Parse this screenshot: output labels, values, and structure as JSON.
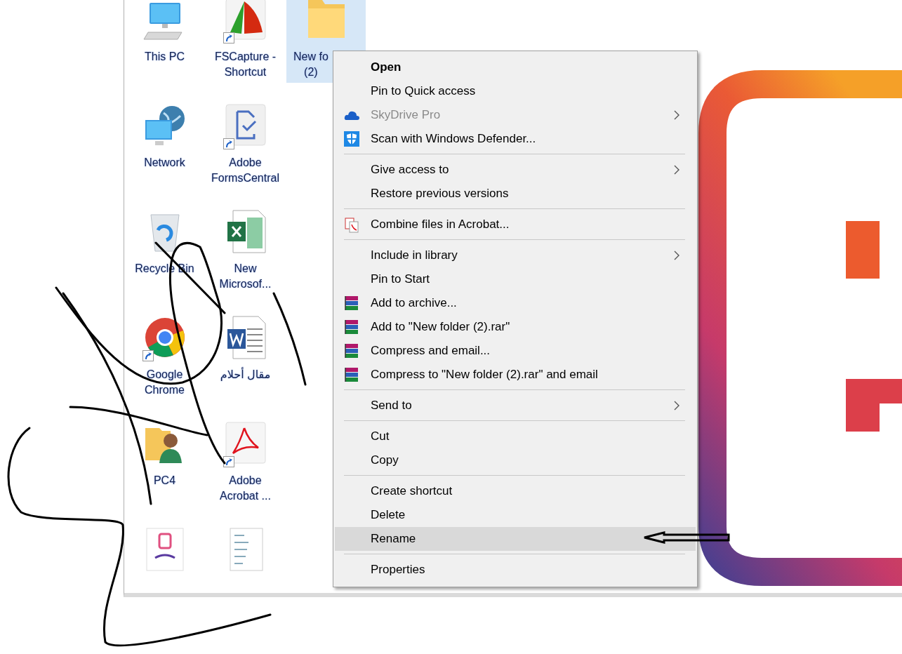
{
  "desktop": {
    "icons": [
      {
        "label": [
          "This PC"
        ],
        "kind": "pc",
        "shortcut": false,
        "selected": false
      },
      {
        "label": [
          "Network"
        ],
        "kind": "network",
        "shortcut": false,
        "selected": false
      },
      {
        "label": [
          "Recycle Bin"
        ],
        "kind": "bin",
        "shortcut": false,
        "selected": false
      },
      {
        "label": [
          "Google",
          "Chrome"
        ],
        "kind": "chrome",
        "shortcut": true,
        "selected": false
      },
      {
        "label": [
          "PC4"
        ],
        "kind": "userfolder",
        "shortcut": false,
        "selected": false
      },
      {
        "kind": "apptile",
        "shortcut": false,
        "selected": false
      },
      {
        "label": [
          "FSCapture -",
          "Shortcut"
        ],
        "kind": "fan",
        "shortcut": true,
        "selected": false
      },
      {
        "label": [
          "Adobe",
          "FormsCentral"
        ],
        "kind": "forms",
        "shortcut": true,
        "selected": false
      },
      {
        "label": [
          "New",
          "Microsof..."
        ],
        "kind": "excel",
        "shortcut": false,
        "selected": false
      },
      {
        "label": [
          "مقال أحلام"
        ],
        "kind": "word",
        "shortcut": false,
        "selected": false
      },
      {
        "label": [
          "Adobe",
          "Acrobat ..."
        ],
        "kind": "pdf",
        "shortcut": true,
        "selected": false
      },
      {
        "kind": "docthumb",
        "shortcut": false,
        "selected": false
      },
      {
        "label": [
          "New fo",
          "(2)"
        ],
        "kind": "folder",
        "shortcut": false,
        "selected": true
      }
    ]
  },
  "context_menu": {
    "items": [
      {
        "kind": "item",
        "label": "Open",
        "bold": true,
        "disabled": false,
        "submenu": false,
        "selected": false
      },
      {
        "kind": "item",
        "label": "Pin to Quick access",
        "bold": false,
        "disabled": false,
        "submenu": false,
        "selected": false
      },
      {
        "kind": "cloud",
        "label": "SkyDrive Pro",
        "bold": false,
        "disabled": true,
        "submenu": true,
        "selected": false
      },
      {
        "kind": "shield",
        "label": "Scan with Windows Defender...",
        "bold": false,
        "disabled": false,
        "submenu": false,
        "selected": false
      },
      {
        "kind": "separator"
      },
      {
        "kind": "item",
        "label": "Give access to",
        "bold": false,
        "disabled": false,
        "submenu": true,
        "selected": false
      },
      {
        "kind": "item",
        "label": "Restore previous versions",
        "bold": false,
        "disabled": false,
        "submenu": false,
        "selected": false
      },
      {
        "kind": "separator"
      },
      {
        "kind": "combine",
        "label": "Combine files in Acrobat...",
        "bold": false,
        "disabled": false,
        "submenu": false,
        "selected": false
      },
      {
        "kind": "separator"
      },
      {
        "kind": "item",
        "label": "Include in library",
        "bold": false,
        "disabled": false,
        "submenu": true,
        "selected": false
      },
      {
        "kind": "item",
        "label": "Pin to Start",
        "bold": false,
        "disabled": false,
        "submenu": false,
        "selected": false
      },
      {
        "kind": "archive",
        "label": "Add to archive...",
        "bold": false,
        "disabled": false,
        "submenu": false,
        "selected": false
      },
      {
        "kind": "archive",
        "label": "Add to \"New folder (2).rar\"",
        "bold": false,
        "disabled": false,
        "submenu": false,
        "selected": false
      },
      {
        "kind": "archive",
        "label": "Compress and email...",
        "bold": false,
        "disabled": false,
        "submenu": false,
        "selected": false
      },
      {
        "kind": "archive",
        "label": "Compress to \"New folder (2).rar\" and email",
        "bold": false,
        "disabled": false,
        "submenu": false,
        "selected": false
      },
      {
        "kind": "separator"
      },
      {
        "kind": "item",
        "label": "Send to",
        "bold": false,
        "disabled": false,
        "submenu": true,
        "selected": false
      },
      {
        "kind": "separator"
      },
      {
        "kind": "item",
        "label": "Cut",
        "bold": false,
        "disabled": false,
        "submenu": false,
        "selected": false
      },
      {
        "kind": "item",
        "label": "Copy",
        "bold": false,
        "disabled": false,
        "submenu": false,
        "selected": false
      },
      {
        "kind": "separator"
      },
      {
        "kind": "item",
        "label": "Create shortcut",
        "bold": false,
        "disabled": false,
        "submenu": false,
        "selected": false
      },
      {
        "kind": "item",
        "label": "Delete",
        "bold": false,
        "disabled": false,
        "submenu": false,
        "selected": false
      },
      {
        "kind": "item",
        "label": "Rename",
        "bold": false,
        "disabled": false,
        "submenu": false,
        "selected": true
      },
      {
        "kind": "separator"
      },
      {
        "kind": "item",
        "label": "Properties",
        "bold": false,
        "disabled": false,
        "submenu": false,
        "selected": false
      }
    ]
  }
}
